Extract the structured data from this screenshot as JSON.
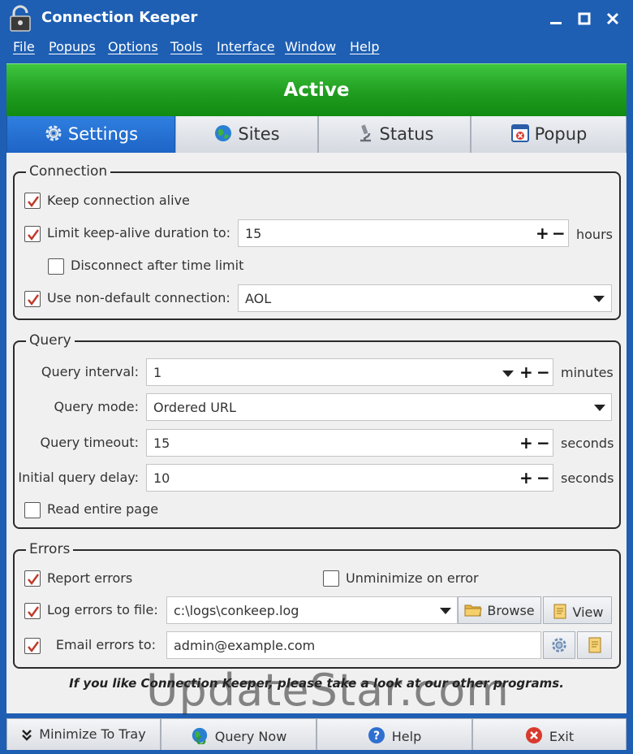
{
  "window": {
    "title": "Connection Keeper"
  },
  "menu": [
    "File",
    "Popups",
    "Options",
    "Tools",
    "Interface",
    "Window",
    "Help"
  ],
  "status": {
    "label": "Active",
    "color": "#22a022"
  },
  "tabs": [
    "Settings",
    "Sites",
    "Status",
    "Popup"
  ],
  "connection": {
    "legend": "Connection",
    "keep_alive": {
      "label": "Keep connection alive",
      "checked": true
    },
    "limit_duration": {
      "label": "Limit keep-alive duration to:",
      "checked": true,
      "value": "15",
      "unit": "hours"
    },
    "disconnect_after": {
      "label": "Disconnect after time limit",
      "checked": false
    },
    "non_default": {
      "label": "Use non-default connection:",
      "checked": true,
      "value": "AOL"
    }
  },
  "query": {
    "legend": "Query",
    "interval": {
      "label": "Query interval:",
      "value": "1",
      "unit": "minutes"
    },
    "mode": {
      "label": "Query mode:",
      "value": "Ordered URL"
    },
    "timeout": {
      "label": "Query timeout:",
      "value": "15",
      "unit": "seconds"
    },
    "initial_delay": {
      "label": "Initial query delay:",
      "value": "10",
      "unit": "seconds"
    },
    "read_entire": {
      "label": "Read entire page",
      "checked": false
    }
  },
  "errors": {
    "legend": "Errors",
    "report": {
      "label": "Report errors",
      "checked": true
    },
    "unminimize": {
      "label": "Unminimize on error",
      "checked": false
    },
    "log": {
      "label": "Log errors to file:",
      "checked": true,
      "value": "c:\\logs\\conkeep.log",
      "browse": "Browse",
      "view": "View"
    },
    "email": {
      "label": "Email errors to:",
      "checked": true,
      "value": "admin@example.com"
    }
  },
  "promo": "If you like Connection Keeper, please take a look at our other programs.",
  "watermark": "UpdateStar.com",
  "bottom": {
    "minimize": "Minimize To Tray",
    "query_now": "Query Now",
    "help": "Help",
    "exit": "Exit"
  },
  "colors": {
    "titlebar": "#1e5fb3",
    "tab_active": "#2f7fe0",
    "check": "#c0392b"
  }
}
